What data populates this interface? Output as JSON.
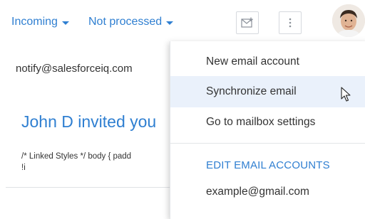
{
  "toolbar": {
    "filter_1": "Incoming",
    "filter_2": "Not processed"
  },
  "email": {
    "from": "notify@salesforceiq.com",
    "subject": "John D invited you",
    "body_line_1": "/* Linked Styles */ body { padd",
    "body_line_2": "!i"
  },
  "menu": {
    "items": [
      {
        "label": "New email account"
      },
      {
        "label": "Synchronize email"
      },
      {
        "label": "Go to mailbox settings"
      }
    ],
    "section_header": "EDIT EMAIL ACCOUNTS",
    "accounts": [
      {
        "label": "example@gmail.com"
      }
    ]
  },
  "icons": {
    "new_email": "new-email-icon",
    "more": "more-vertical-icon",
    "cursor": "mouse-pointer-icon"
  },
  "colors": {
    "accent": "#2f7fd1",
    "hover_bg": "#eaf1fb",
    "text": "#333333"
  }
}
